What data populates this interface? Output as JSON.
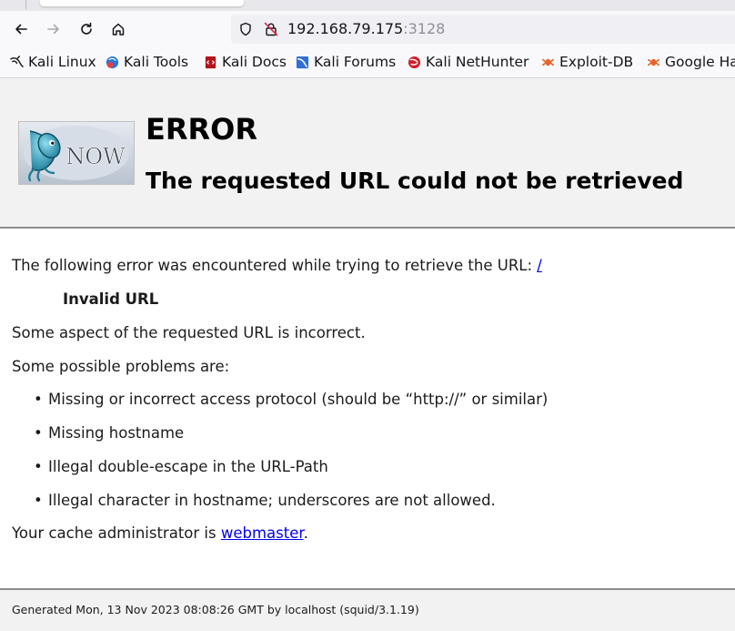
{
  "browser": {
    "url_host": "192.168.79.175",
    "url_port": ":3128",
    "bookmarks": [
      {
        "label": "Kali Linux",
        "icon": "kali-dragon-icon"
      },
      {
        "label": "Kali Tools",
        "icon": "kali-tools-icon"
      },
      {
        "label": "Kali Docs",
        "icon": "kali-docs-icon"
      },
      {
        "label": "Kali Forums",
        "icon": "kali-forums-icon"
      },
      {
        "label": "Kali NetHunter",
        "icon": "kali-nethunter-icon"
      },
      {
        "label": "Exploit-DB",
        "icon": "exploit-db-icon"
      },
      {
        "label": "Google Ha",
        "icon": "google-hacking-icon"
      }
    ]
  },
  "header": {
    "logo_text": "NOW",
    "title": "ERROR",
    "subtitle": "The requested URL could not be retrieved"
  },
  "body": {
    "intro": "The following error was encountered while trying to retrieve the URL: ",
    "intro_link": "/",
    "error_code": "Invalid URL",
    "description": "Some aspect of the requested URL is incorrect.",
    "problems_heading": "Some possible problems are:",
    "problems": [
      "Missing or incorrect access protocol (should be “http://” or similar)",
      "Missing hostname",
      "Illegal double-escape in the URL-Path",
      "Illegal character in hostname; underscores are not allowed."
    ],
    "admin_prefix": "Your cache administrator is ",
    "admin_link": "webmaster",
    "admin_suffix": "."
  },
  "footer": {
    "generated": "Generated Mon, 13 Nov 2023 08:08:26 GMT by localhost (squid/3.1.19)"
  },
  "colors": {
    "link": "#0000ee",
    "header_bg": "#f2f2f2",
    "rule": "#8d8d8d"
  }
}
